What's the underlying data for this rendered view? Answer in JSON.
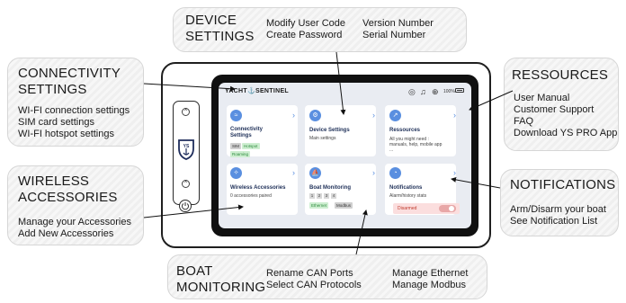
{
  "callouts": {
    "device": {
      "title_line1": "DEVICE",
      "title_line2": "SETTINGS",
      "col1": [
        "Modify User Code",
        "Create Password"
      ],
      "col2": [
        "Version Number",
        "Serial Number"
      ]
    },
    "connectivity": {
      "title_line1": "CONNECTIVITY",
      "title_line2": "SETTINGS",
      "lines": [
        "WI-FI connection settings",
        "SIM card settings",
        "WI-FI hotspot settings"
      ]
    },
    "wireless": {
      "title_line1": "WIRELESS",
      "title_line2": "ACCESSORIES",
      "lines": [
        "Manage your Accessories",
        "Add New Accessories"
      ]
    },
    "ressources": {
      "title": "RESSOURCES",
      "lines": [
        "User Manual",
        "Customer Support",
        "FAQ",
        "Download YS PRO App"
      ]
    },
    "notifications": {
      "title": "NOTIFICATIONS",
      "lines": [
        "Arm/Disarm your boat",
        "See Notification List"
      ]
    },
    "boat": {
      "title_line1": "BOAT",
      "title_line2": "MONITORING",
      "col1": [
        "Rename CAN Ports",
        "Select CAN Protocols"
      ],
      "col2": [
        "Manage Ethernet",
        "Manage Modbus"
      ]
    }
  },
  "screen": {
    "brand": "YACHT⚓SENTINEL",
    "battery": "100%",
    "status_icons": [
      "signal-icon",
      "bell-off-icon",
      "gps-icon"
    ],
    "cards": {
      "connectivity": {
        "title": "Connectivity Settings",
        "tags": [
          "SIM",
          "Hotspot",
          "Roaming"
        ]
      },
      "device": {
        "title": "Device Settings",
        "sub": "Main settings"
      },
      "ressources": {
        "title": "Ressources",
        "sub1": "All you might need :",
        "sub2": "manuals, help, mobile app",
        "sub3": "..."
      },
      "wireless": {
        "title": "Wireless Accessories",
        "sub": "0 accessories paired"
      },
      "boat": {
        "title": "Boat Monitoring",
        "ports": [
          "1",
          "2",
          "3",
          "4"
        ],
        "tags": [
          "Ethernet",
          "Modbus"
        ]
      },
      "notifications": {
        "title": "Notifications",
        "sub": "Alarm/history stats",
        "toggle_label": "Disarmed"
      }
    }
  },
  "colors": {
    "accent": "#5a8fe0",
    "card_title": "#21325a",
    "disarmed": "#c0392b"
  }
}
